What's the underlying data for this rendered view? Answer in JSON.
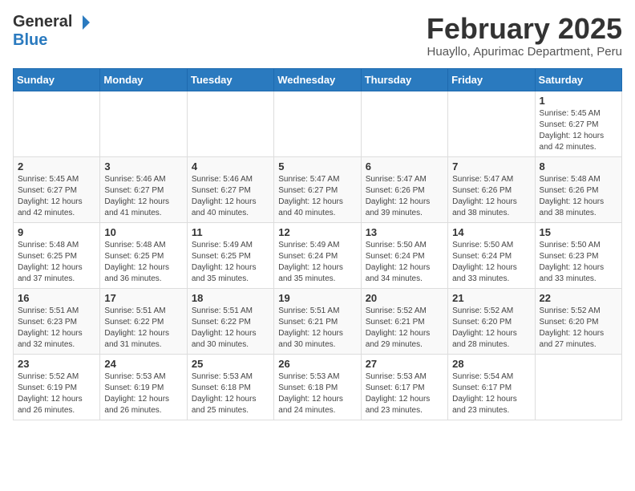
{
  "header": {
    "logo_general": "General",
    "logo_blue": "Blue",
    "title": "February 2025",
    "location": "Huayllo, Apurimac Department, Peru"
  },
  "calendar": {
    "days_of_week": [
      "Sunday",
      "Monday",
      "Tuesday",
      "Wednesday",
      "Thursday",
      "Friday",
      "Saturday"
    ],
    "weeks": [
      [
        {
          "day": "",
          "info": ""
        },
        {
          "day": "",
          "info": ""
        },
        {
          "day": "",
          "info": ""
        },
        {
          "day": "",
          "info": ""
        },
        {
          "day": "",
          "info": ""
        },
        {
          "day": "",
          "info": ""
        },
        {
          "day": "1",
          "info": "Sunrise: 5:45 AM\nSunset: 6:27 PM\nDaylight: 12 hours\nand 42 minutes."
        }
      ],
      [
        {
          "day": "2",
          "info": "Sunrise: 5:45 AM\nSunset: 6:27 PM\nDaylight: 12 hours\nand 42 minutes."
        },
        {
          "day": "3",
          "info": "Sunrise: 5:46 AM\nSunset: 6:27 PM\nDaylight: 12 hours\nand 41 minutes."
        },
        {
          "day": "4",
          "info": "Sunrise: 5:46 AM\nSunset: 6:27 PM\nDaylight: 12 hours\nand 40 minutes."
        },
        {
          "day": "5",
          "info": "Sunrise: 5:47 AM\nSunset: 6:27 PM\nDaylight: 12 hours\nand 40 minutes."
        },
        {
          "day": "6",
          "info": "Sunrise: 5:47 AM\nSunset: 6:26 PM\nDaylight: 12 hours\nand 39 minutes."
        },
        {
          "day": "7",
          "info": "Sunrise: 5:47 AM\nSunset: 6:26 PM\nDaylight: 12 hours\nand 38 minutes."
        },
        {
          "day": "8",
          "info": "Sunrise: 5:48 AM\nSunset: 6:26 PM\nDaylight: 12 hours\nand 38 minutes."
        }
      ],
      [
        {
          "day": "9",
          "info": "Sunrise: 5:48 AM\nSunset: 6:25 PM\nDaylight: 12 hours\nand 37 minutes."
        },
        {
          "day": "10",
          "info": "Sunrise: 5:48 AM\nSunset: 6:25 PM\nDaylight: 12 hours\nand 36 minutes."
        },
        {
          "day": "11",
          "info": "Sunrise: 5:49 AM\nSunset: 6:25 PM\nDaylight: 12 hours\nand 35 minutes."
        },
        {
          "day": "12",
          "info": "Sunrise: 5:49 AM\nSunset: 6:24 PM\nDaylight: 12 hours\nand 35 minutes."
        },
        {
          "day": "13",
          "info": "Sunrise: 5:50 AM\nSunset: 6:24 PM\nDaylight: 12 hours\nand 34 minutes."
        },
        {
          "day": "14",
          "info": "Sunrise: 5:50 AM\nSunset: 6:24 PM\nDaylight: 12 hours\nand 33 minutes."
        },
        {
          "day": "15",
          "info": "Sunrise: 5:50 AM\nSunset: 6:23 PM\nDaylight: 12 hours\nand 33 minutes."
        }
      ],
      [
        {
          "day": "16",
          "info": "Sunrise: 5:51 AM\nSunset: 6:23 PM\nDaylight: 12 hours\nand 32 minutes."
        },
        {
          "day": "17",
          "info": "Sunrise: 5:51 AM\nSunset: 6:22 PM\nDaylight: 12 hours\nand 31 minutes."
        },
        {
          "day": "18",
          "info": "Sunrise: 5:51 AM\nSunset: 6:22 PM\nDaylight: 12 hours\nand 30 minutes."
        },
        {
          "day": "19",
          "info": "Sunrise: 5:51 AM\nSunset: 6:21 PM\nDaylight: 12 hours\nand 30 minutes."
        },
        {
          "day": "20",
          "info": "Sunrise: 5:52 AM\nSunset: 6:21 PM\nDaylight: 12 hours\nand 29 minutes."
        },
        {
          "day": "21",
          "info": "Sunrise: 5:52 AM\nSunset: 6:20 PM\nDaylight: 12 hours\nand 28 minutes."
        },
        {
          "day": "22",
          "info": "Sunrise: 5:52 AM\nSunset: 6:20 PM\nDaylight: 12 hours\nand 27 minutes."
        }
      ],
      [
        {
          "day": "23",
          "info": "Sunrise: 5:52 AM\nSunset: 6:19 PM\nDaylight: 12 hours\nand 26 minutes."
        },
        {
          "day": "24",
          "info": "Sunrise: 5:53 AM\nSunset: 6:19 PM\nDaylight: 12 hours\nand 26 minutes."
        },
        {
          "day": "25",
          "info": "Sunrise: 5:53 AM\nSunset: 6:18 PM\nDaylight: 12 hours\nand 25 minutes."
        },
        {
          "day": "26",
          "info": "Sunrise: 5:53 AM\nSunset: 6:18 PM\nDaylight: 12 hours\nand 24 minutes."
        },
        {
          "day": "27",
          "info": "Sunrise: 5:53 AM\nSunset: 6:17 PM\nDaylight: 12 hours\nand 23 minutes."
        },
        {
          "day": "28",
          "info": "Sunrise: 5:54 AM\nSunset: 6:17 PM\nDaylight: 12 hours\nand 23 minutes."
        },
        {
          "day": "",
          "info": ""
        }
      ]
    ]
  }
}
